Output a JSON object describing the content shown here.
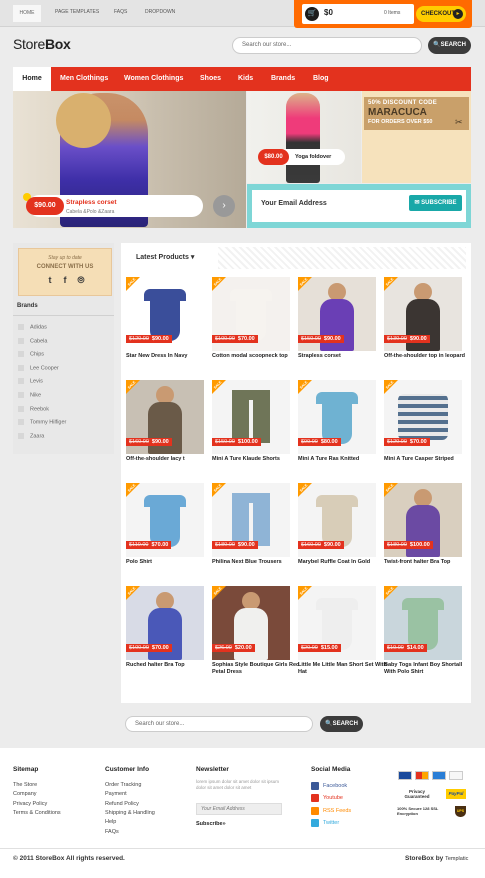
{
  "top_nav": [
    "HOME",
    "PAGE TEMPLATES",
    "FAQS",
    "DROPDOWN"
  ],
  "cart": {
    "total": "$0",
    "items": "0 Items",
    "checkout_label": "CHECKOUT",
    "arrow": "▸"
  },
  "brand": {
    "logo_light": "Store",
    "logo_bold": "Box"
  },
  "search": {
    "placeholder": "Search our store...",
    "button": "SEARCH"
  },
  "main_nav": [
    "Home",
    "Men Clothings",
    "Women Clothings",
    "Shoes",
    "Kids",
    "Brands",
    "Blog"
  ],
  "hero": {
    "price": "$90.00",
    "title": "Strapless corset",
    "subtitle": "Cabela &Polo &Zaara",
    "next": "›"
  },
  "promo": {
    "price": "$80.00",
    "title": "Yoga foldover"
  },
  "discount": {
    "line1": "50% DISCOUNT CODE",
    "code": "MARACUCA",
    "line3": "FOR ORDERS OVER $50",
    "scissors": "✂"
  },
  "newsletter_bar": {
    "placeholder": "Your Email Address",
    "button": "SUBSCRIBE",
    "icon": "✉"
  },
  "sidebar": {
    "connect_line1": "Stay up to date",
    "connect_line2": "CONNECT WITH US",
    "social_icons": [
      "t",
      "f",
      "rss"
    ],
    "social_glyphs": [
      "t",
      "f",
      "⦾"
    ],
    "brands_title": "Brands",
    "brands": [
      "Adidas",
      "Cabela",
      "Chips",
      "Lee Cooper",
      "Levis",
      "Nike",
      "Reebok",
      "Tommy Hilfiger",
      "Zaara"
    ]
  },
  "products_section": {
    "title": "Latest Products",
    "caret": "▾",
    "sale_label": "SALE"
  },
  "products": [
    {
      "name": "Star New Dress In Navy",
      "old": "$120.00",
      "new": "$90.00"
    },
    {
      "name": "Cotton modal scoopneck top",
      "old": "$100.00",
      "new": "$70.00"
    },
    {
      "name": "Strapless corset",
      "old": "$150.00",
      "new": "$90.00"
    },
    {
      "name": "Off-the-shoulder top in leopard",
      "old": "$130.00",
      "new": "$90.00"
    },
    {
      "name": "Off-the-shoulder lacy t",
      "old": "$160.00",
      "new": "$90.00"
    },
    {
      "name": "Mini A Ture Klaude Shorts",
      "old": "$150.00",
      "new": "$100.00"
    },
    {
      "name": "Mini A Ture Ras Knitted",
      "old": "$99.00",
      "new": "$80.00"
    },
    {
      "name": "Mini A Ture Casper Striped",
      "old": "$120.00",
      "new": "$70.00"
    },
    {
      "name": "Polo Shirt",
      "old": "$110.00",
      "new": "$70.00"
    },
    {
      "name": "Philina Next Blue Trousers",
      "old": "$180.00",
      "new": "$90.00"
    },
    {
      "name": "Marybel Ruffle Coat In Gold",
      "old": "$160.00",
      "new": "$90.00"
    },
    {
      "name": "Twist-front halter Bra Top",
      "old": "$180.00",
      "new": "$100.00"
    },
    {
      "name": "Ruched halter Bra Top",
      "old": "$100.00",
      "new": "$70.00"
    },
    {
      "name": "Sophias Style Boutique Girls Red Petal Dress",
      "old": "$26.00",
      "new": "$20.00"
    },
    {
      "name": "Little Me Little Man Short Set With Hat",
      "old": "$20.00",
      "new": "$15.00"
    },
    {
      "name": "Baby Togs Infant Boy Shortall With Polo Shirt",
      "old": "$19.00",
      "new": "$14.00"
    }
  ],
  "footer": {
    "sitemap_title": "Sitemap",
    "sitemap": [
      "The Store",
      "Company",
      "Privacy Policy",
      "Terms & Conditions"
    ],
    "customer_title": "Customer Info",
    "customer": [
      "Order Tracking",
      "Payment",
      "Refund Policy",
      "Shipping & Handling",
      "Help",
      "FAQs"
    ],
    "newsletter_title": "Newsletter",
    "newsletter_intro": "lorem ipsum dolor sit amet dolor sit ipsum dolor sit amet dolor sit amet",
    "newsletter_placeholder": "Your Email Address",
    "newsletter_button": "Subscribe»",
    "social_title": "Social Media",
    "social": [
      {
        "label": "Facebook",
        "color": "#3b5998"
      },
      {
        "label": "Youtube",
        "color": "#e3321e"
      },
      {
        "label": "RSS Feeds",
        "color": "#ff8a00"
      },
      {
        "label": "Twitter",
        "color": "#33aadd"
      }
    ],
    "badges": {
      "privacy": "Privacy Guaranteed",
      "paypal": "PayPal",
      "secure": "100% Secure 128 SSL Encryption",
      "ups": "UPS"
    },
    "copyright": "© 2011 StoreBox All rights reserved.",
    "credit_brand": "StoreBox by",
    "credit_by": "Templatic"
  },
  "colors": {
    "accent": "#e3321e",
    "orange": "#ff6a00",
    "yellow": "#ffcc00",
    "teal": "#19a8a8"
  }
}
